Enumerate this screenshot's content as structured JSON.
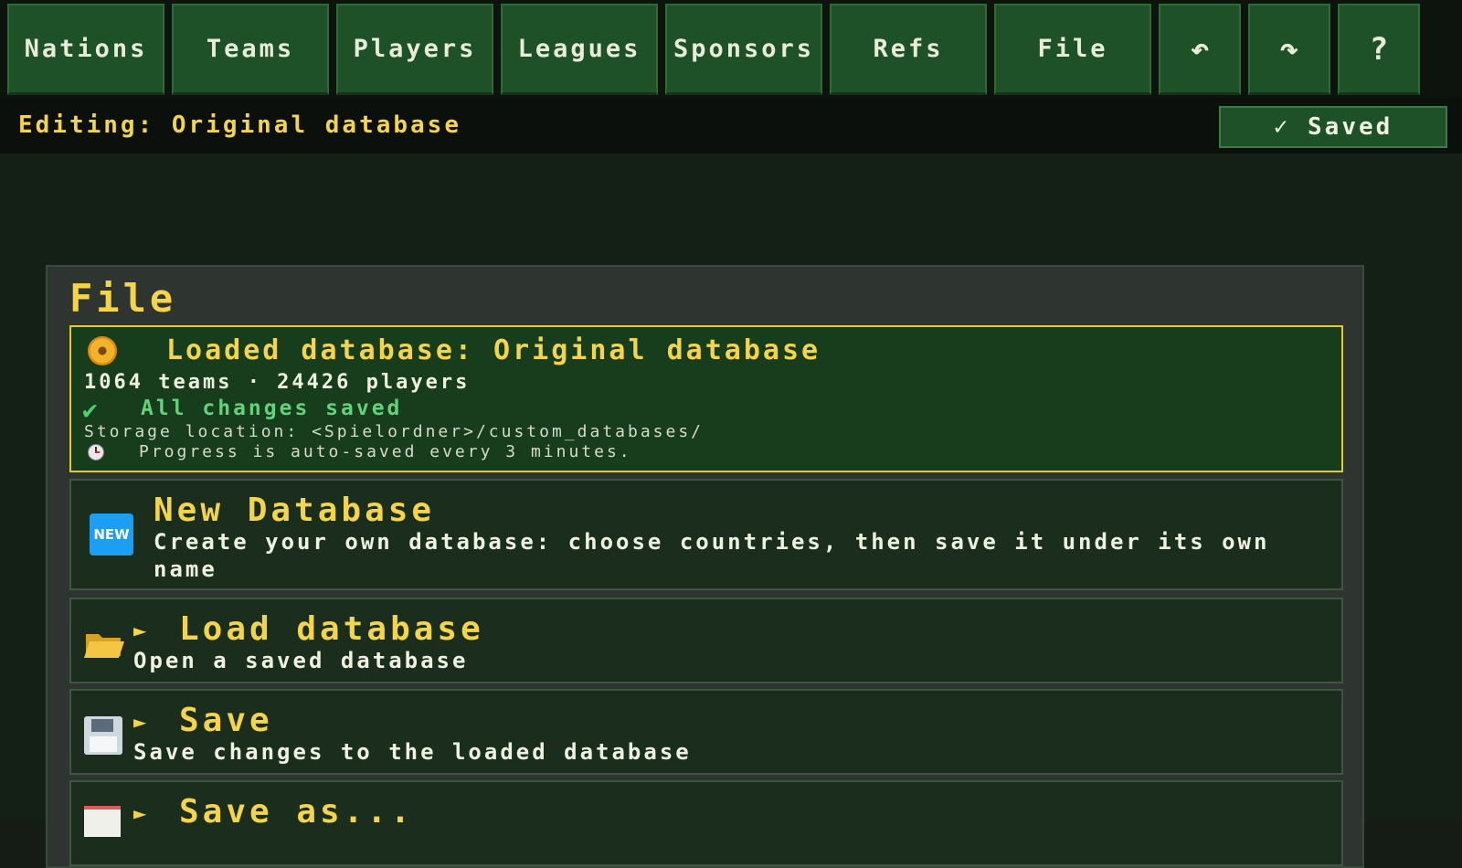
{
  "nav": {
    "nations": "Nations",
    "teams": "Teams",
    "players": "Players",
    "leagues": "Leagues",
    "sponsors": "Sponsors",
    "refs": "Refs",
    "file": "File",
    "undo_icon": "↶",
    "redo_icon": "↷",
    "help": "?"
  },
  "status": {
    "editing": "Editing: Original database",
    "saved_badge": "✓ Saved"
  },
  "panel": {
    "title": "File",
    "loaded": {
      "title": "Loaded database: Original database",
      "stats": "1064 teams · 24426 players",
      "check_icon": "✔",
      "saved_text": "All changes saved",
      "storage": "Storage location: <Spielordner>/custom_databases/",
      "autosave": "Progress is auto-saved every 3 minutes."
    },
    "new_db": {
      "icon_label": "NEW",
      "title": "New Database",
      "desc": "Create your own database: choose countries, then save it under its own name"
    },
    "load_db": {
      "arrow": "►",
      "title": "Load database",
      "desc": "Open a saved database"
    },
    "save": {
      "arrow": "►",
      "title": "Save",
      "desc": "Save changes to the loaded database"
    },
    "save_as": {
      "arrow": "►",
      "title": "Save as..."
    }
  },
  "colors": {
    "accent_yellow": "#f3d44b",
    "nav_green": "#1f5128",
    "success_green": "#62d37a"
  }
}
